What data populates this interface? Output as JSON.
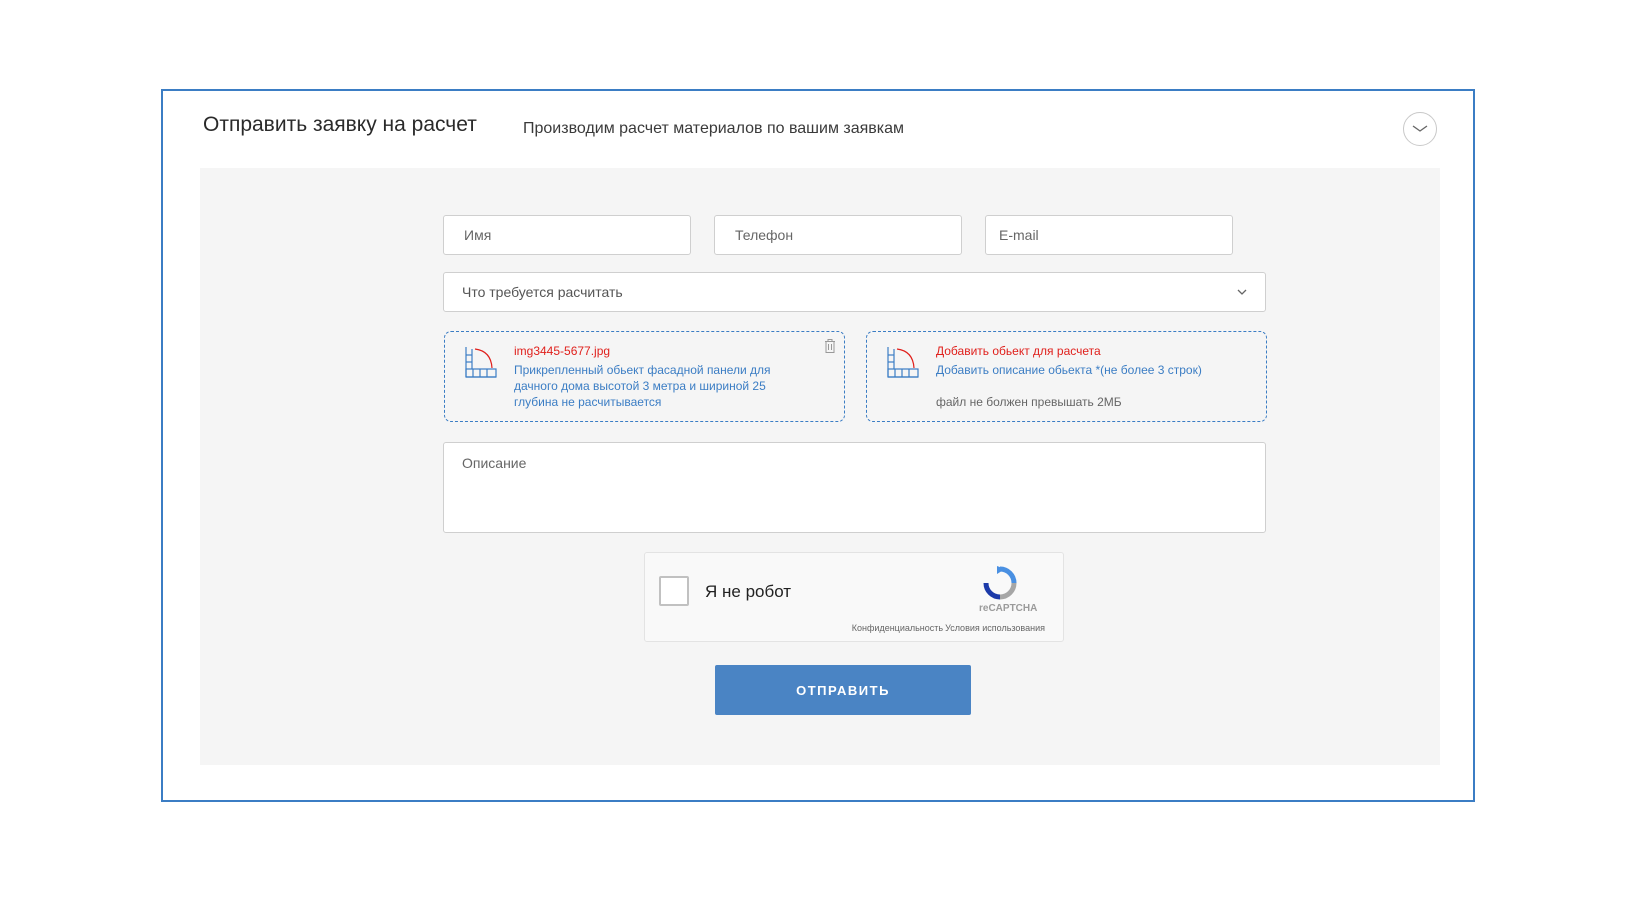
{
  "header": {
    "title": "Отправить заявку на расчет",
    "subtitle": "Производим расчет материалов по вашим заявкам"
  },
  "form": {
    "name_placeholder": "Имя",
    "phone_placeholder": "Телефон",
    "email_placeholder": "E-mail",
    "calc_select_value": "Что требуется расчитать",
    "description_placeholder": "Описание",
    "submit_label": "ОТПРАВИТЬ"
  },
  "attachment": {
    "filename": "img3445-5677.jpg",
    "description": "Прикрепленный обьект фасадной панели для дачного дома высотой 3 метра и шириной 25 глубина не расчитывается"
  },
  "add_object": {
    "title": "Добавить обьект для расчета",
    "description": "Добавить описание обьекта *(не более 3 строк)",
    "hint": "файл не болжен превышать 2МБ"
  },
  "captcha": {
    "label": "Я не робот",
    "brand": "reCAPTCHA",
    "privacy": "Конфиденциальность",
    "terms": "Условия использования"
  },
  "icons": {
    "collapse": "chevron-down-icon",
    "attachment": "blueprint-icon",
    "delete": "trash-icon",
    "select": "chevron-down-icon"
  },
  "colors": {
    "border_accent": "#3b7dc4",
    "button": "#4a84c4",
    "error_red": "#e0201c",
    "link_blue": "#3b7dc4"
  }
}
